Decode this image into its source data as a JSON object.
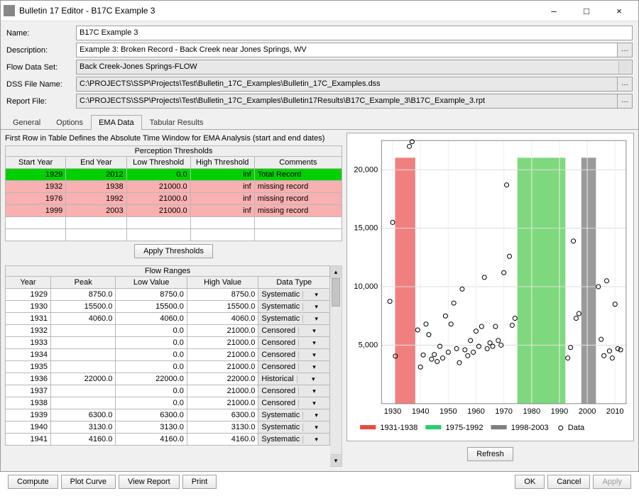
{
  "window": {
    "title": "Bulletin 17 Editor - B17C Example 3",
    "minimize": "–",
    "maximize": "□",
    "close": "×"
  },
  "form": {
    "name_label": "Name:",
    "name_value": "B17C Example 3",
    "desc_label": "Description:",
    "desc_value": "Example 3: Broken Record - Back Creek near Jones Springs, WV",
    "flow_label": "Flow Data Set:",
    "flow_value": "Back Creek-Jones Springs-FLOW",
    "dss_label": "DSS File Name:",
    "dss_value": "C:\\PROJECTS\\SSP\\Projects\\Test\\Bulletin_17C_Examples\\Bulletin_17C_Examples.dss",
    "report_label": "Report File:",
    "report_value": "C:\\PROJECTS\\SSP\\Projects\\Test\\Bulletin_17C_Examples\\Bulletin17Results\\B17C_Example_3\\B17C_Example_3.rpt"
  },
  "tabs": {
    "general": "General",
    "options": "Options",
    "ema": "EMA Data",
    "tabular": "Tabular Results"
  },
  "ema": {
    "hint": "First Row in Table Defines the Absolute Time Window for EMA Analysis (start and end dates)",
    "perception_caption": "Perception Thresholds",
    "headers": {
      "sy": "Start Year",
      "ey": "End Year",
      "lt": "Low Threshold",
      "ht": "High Threshold",
      "cm": "Comments"
    },
    "rows": [
      {
        "sy": "1929",
        "ey": "2012",
        "lt": "0.0",
        "ht": "inf",
        "cm": "Total Record",
        "cls": "row-green"
      },
      {
        "sy": "1932",
        "ey": "1938",
        "lt": "21000.0",
        "ht": "inf",
        "cm": "missing record",
        "cls": "row-pink"
      },
      {
        "sy": "1976",
        "ey": "1992",
        "lt": "21000.0",
        "ht": "inf",
        "cm": "missing record",
        "cls": "row-pink"
      },
      {
        "sy": "1999",
        "ey": "2003",
        "lt": "21000.0",
        "ht": "inf",
        "cm": "missing record",
        "cls": "row-pink"
      }
    ],
    "apply_btn": "Apply Thresholds",
    "flow_caption": "Flow Ranges",
    "flow_headers": {
      "yr": "Year",
      "pk": "Peak",
      "lv": "Low Value",
      "hv": "High Value",
      "dt": "Data Type"
    },
    "flow_rows": [
      {
        "yr": "1929",
        "pk": "8750.0",
        "lv": "8750.0",
        "hv": "8750.0",
        "dt": "Systematic"
      },
      {
        "yr": "1930",
        "pk": "15500.0",
        "lv": "15500.0",
        "hv": "15500.0",
        "dt": "Systematic"
      },
      {
        "yr": "1931",
        "pk": "4060.0",
        "lv": "4060.0",
        "hv": "4060.0",
        "dt": "Systematic"
      },
      {
        "yr": "1932",
        "pk": "",
        "lv": "0.0",
        "hv": "21000.0",
        "dt": "Censored"
      },
      {
        "yr": "1933",
        "pk": "",
        "lv": "0.0",
        "hv": "21000.0",
        "dt": "Censored"
      },
      {
        "yr": "1934",
        "pk": "",
        "lv": "0.0",
        "hv": "21000.0",
        "dt": "Censored"
      },
      {
        "yr": "1935",
        "pk": "",
        "lv": "0.0",
        "hv": "21000.0",
        "dt": "Censored"
      },
      {
        "yr": "1936",
        "pk": "22000.0",
        "lv": "22000.0",
        "hv": "22000.0",
        "dt": "Historical"
      },
      {
        "yr": "1937",
        "pk": "",
        "lv": "0.0",
        "hv": "21000.0",
        "dt": "Censored"
      },
      {
        "yr": "1938",
        "pk": "",
        "lv": "0.0",
        "hv": "21000.0",
        "dt": "Censored"
      },
      {
        "yr": "1939",
        "pk": "6300.0",
        "lv": "6300.0",
        "hv": "6300.0",
        "dt": "Systematic"
      },
      {
        "yr": "1940",
        "pk": "3130.0",
        "lv": "3130.0",
        "hv": "3130.0",
        "dt": "Systematic"
      },
      {
        "yr": "1941",
        "pk": "4160.0",
        "lv": "4160.0",
        "hv": "4160.0",
        "dt": "Systematic"
      }
    ]
  },
  "bottom": {
    "compute": "Compute",
    "plot": "Plot Curve",
    "view": "View Report",
    "print": "Print",
    "ok": "OK",
    "cancel": "Cancel",
    "apply": "Apply",
    "refresh": "Refresh"
  },
  "chart_data": {
    "type": "scatter+bars",
    "xlim": [
      1926,
      2014
    ],
    "ylim": [
      0,
      22500
    ],
    "yticks": [
      5000,
      10000,
      15000,
      20000
    ],
    "xticks": [
      1930,
      1940,
      1950,
      1960,
      1970,
      1980,
      1990,
      2000,
      2010
    ],
    "legend": [
      {
        "name": "1931-1938",
        "color": "#e74c3c",
        "type": "block"
      },
      {
        "name": "1975-1992",
        "color": "#2ecc71",
        "type": "block"
      },
      {
        "name": "1998-2003",
        "color": "#7f7f7f",
        "type": "block"
      },
      {
        "name": "Data",
        "color": "#000",
        "type": "point"
      }
    ],
    "bars": [
      {
        "x0": 1931,
        "x1": 1938,
        "y": 21000,
        "color": "#f08080"
      },
      {
        "x0": 1975,
        "x1": 1992,
        "y": 21000,
        "color": "#7ed97e"
      },
      {
        "x0": 1998,
        "x1": 2003,
        "y": 21000,
        "color": "#9a9a9a"
      }
    ],
    "points": [
      {
        "x": 1929,
        "y": 8750
      },
      {
        "x": 1930,
        "y": 15500
      },
      {
        "x": 1931,
        "y": 4060
      },
      {
        "x": 1936,
        "y": 22000
      },
      {
        "x": 1937,
        "y": 22400
      },
      {
        "x": 1939,
        "y": 6300
      },
      {
        "x": 1940,
        "y": 3130
      },
      {
        "x": 1941,
        "y": 4160
      },
      {
        "x": 1942,
        "y": 6800
      },
      {
        "x": 1943,
        "y": 5900
      },
      {
        "x": 1944,
        "y": 3800
      },
      {
        "x": 1945,
        "y": 4200
      },
      {
        "x": 1946,
        "y": 3600
      },
      {
        "x": 1947,
        "y": 4900
      },
      {
        "x": 1948,
        "y": 3900
      },
      {
        "x": 1949,
        "y": 7500
      },
      {
        "x": 1950,
        "y": 4400
      },
      {
        "x": 1951,
        "y": 6800
      },
      {
        "x": 1952,
        "y": 8600
      },
      {
        "x": 1953,
        "y": 4700
      },
      {
        "x": 1954,
        "y": 3500
      },
      {
        "x": 1955,
        "y": 9800
      },
      {
        "x": 1956,
        "y": 4600
      },
      {
        "x": 1957,
        "y": 4100
      },
      {
        "x": 1958,
        "y": 5400
      },
      {
        "x": 1959,
        "y": 4400
      },
      {
        "x": 1960,
        "y": 6200
      },
      {
        "x": 1961,
        "y": 4900
      },
      {
        "x": 1962,
        "y": 6600
      },
      {
        "x": 1963,
        "y": 10800
      },
      {
        "x": 1964,
        "y": 4700
      },
      {
        "x": 1965,
        "y": 5200
      },
      {
        "x": 1966,
        "y": 4900
      },
      {
        "x": 1967,
        "y": 6600
      },
      {
        "x": 1968,
        "y": 5400
      },
      {
        "x": 1969,
        "y": 5000
      },
      {
        "x": 1970,
        "y": 11200
      },
      {
        "x": 1971,
        "y": 18700
      },
      {
        "x": 1972,
        "y": 12600
      },
      {
        "x": 1973,
        "y": 6700
      },
      {
        "x": 1974,
        "y": 7300
      },
      {
        "x": 1993,
        "y": 3900
      },
      {
        "x": 1994,
        "y": 4800
      },
      {
        "x": 1995,
        "y": 13900
      },
      {
        "x": 1996,
        "y": 7300
      },
      {
        "x": 1997,
        "y": 7700
      },
      {
        "x": 2004,
        "y": 10000
      },
      {
        "x": 2005,
        "y": 5500
      },
      {
        "x": 2006,
        "y": 4100
      },
      {
        "x": 2007,
        "y": 10500
      },
      {
        "x": 2008,
        "y": 4500
      },
      {
        "x": 2009,
        "y": 3900
      },
      {
        "x": 2010,
        "y": 8500
      },
      {
        "x": 2011,
        "y": 4700
      },
      {
        "x": 2012,
        "y": 4600
      }
    ]
  }
}
